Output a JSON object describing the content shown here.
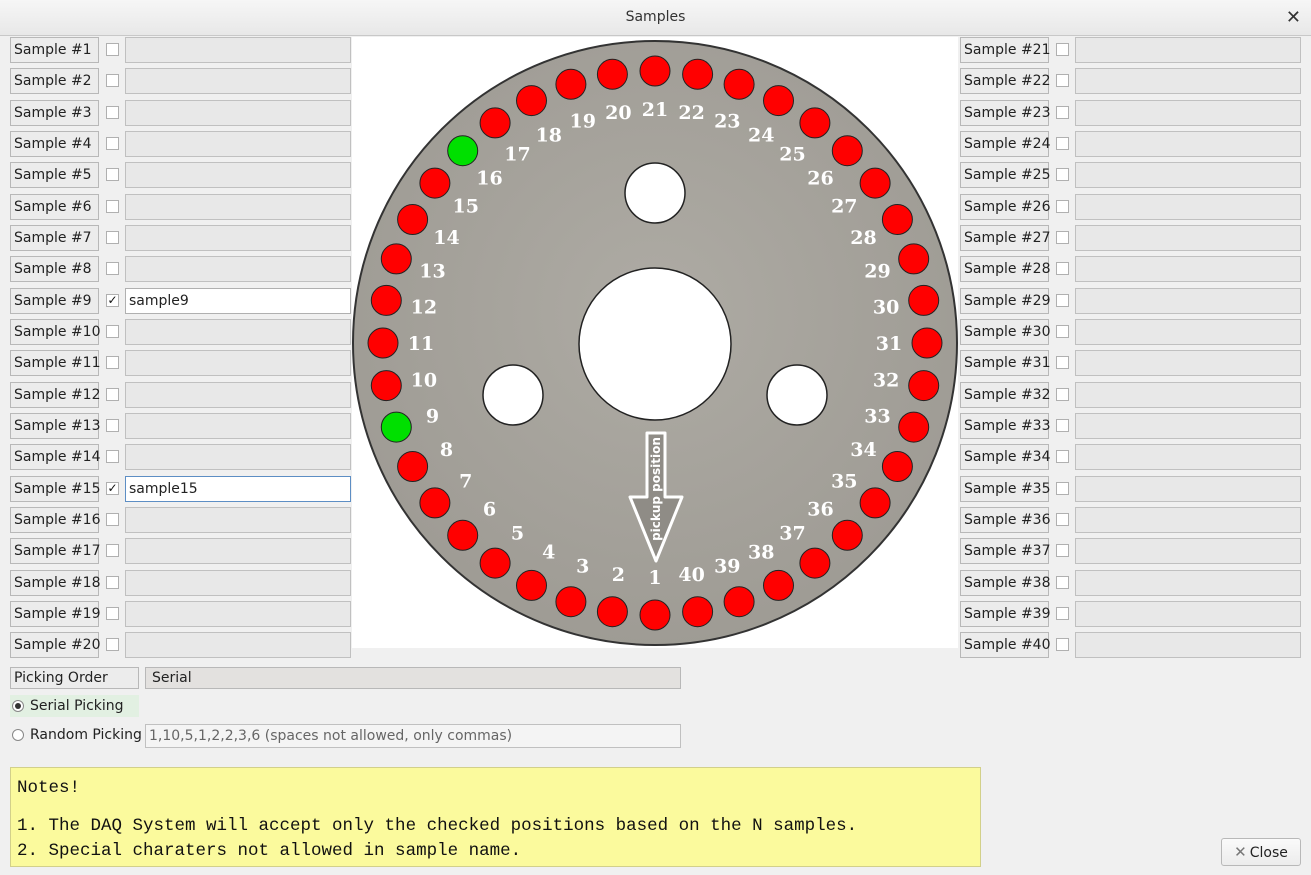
{
  "window": {
    "title": "Samples",
    "close_glyph": "✕"
  },
  "samples_left": [
    {
      "label": "Sample #1",
      "checked": false,
      "value": ""
    },
    {
      "label": "Sample #2",
      "checked": false,
      "value": ""
    },
    {
      "label": "Sample #3",
      "checked": false,
      "value": ""
    },
    {
      "label": "Sample #4",
      "checked": false,
      "value": ""
    },
    {
      "label": "Sample #5",
      "checked": false,
      "value": ""
    },
    {
      "label": "Sample #6",
      "checked": false,
      "value": ""
    },
    {
      "label": "Sample #7",
      "checked": false,
      "value": ""
    },
    {
      "label": "Sample #8",
      "checked": false,
      "value": ""
    },
    {
      "label": "Sample #9",
      "checked": true,
      "value": "sample9"
    },
    {
      "label": "Sample #10",
      "checked": false,
      "value": ""
    },
    {
      "label": "Sample #11",
      "checked": false,
      "value": ""
    },
    {
      "label": "Sample #12",
      "checked": false,
      "value": ""
    },
    {
      "label": "Sample #13",
      "checked": false,
      "value": ""
    },
    {
      "label": "Sample #14",
      "checked": false,
      "value": ""
    },
    {
      "label": "Sample #15",
      "checked": true,
      "value": "sample15"
    },
    {
      "label": "Sample #16",
      "checked": false,
      "value": ""
    },
    {
      "label": "Sample #17",
      "checked": false,
      "value": ""
    },
    {
      "label": "Sample #18",
      "checked": false,
      "value": ""
    },
    {
      "label": "Sample #19",
      "checked": false,
      "value": ""
    },
    {
      "label": "Sample #20",
      "checked": false,
      "value": ""
    }
  ],
  "samples_right": [
    {
      "label": "Sample #21",
      "checked": false,
      "value": ""
    },
    {
      "label": "Sample #22",
      "checked": false,
      "value": ""
    },
    {
      "label": "Sample #23",
      "checked": false,
      "value": ""
    },
    {
      "label": "Sample #24",
      "checked": false,
      "value": ""
    },
    {
      "label": "Sample #25",
      "checked": false,
      "value": ""
    },
    {
      "label": "Sample #26",
      "checked": false,
      "value": ""
    },
    {
      "label": "Sample #27",
      "checked": false,
      "value": ""
    },
    {
      "label": "Sample #28",
      "checked": false,
      "value": ""
    },
    {
      "label": "Sample #29",
      "checked": false,
      "value": ""
    },
    {
      "label": "Sample #30",
      "checked": false,
      "value": ""
    },
    {
      "label": "Sample #31",
      "checked": false,
      "value": ""
    },
    {
      "label": "Sample #32",
      "checked": false,
      "value": ""
    },
    {
      "label": "Sample #33",
      "checked": false,
      "value": ""
    },
    {
      "label": "Sample #34",
      "checked": false,
      "value": ""
    },
    {
      "label": "Sample #35",
      "checked": false,
      "value": ""
    },
    {
      "label": "Sample #36",
      "checked": false,
      "value": ""
    },
    {
      "label": "Sample #37",
      "checked": false,
      "value": ""
    },
    {
      "label": "Sample #38",
      "checked": false,
      "value": ""
    },
    {
      "label": "Sample #39",
      "checked": false,
      "value": ""
    },
    {
      "label": "Sample #40",
      "checked": false,
      "value": ""
    }
  ],
  "check_glyph": "✓",
  "plate": {
    "positions": 40,
    "selected": [
      9,
      16
    ],
    "pickup_label": "pickup position",
    "colors": {
      "plate": "#a6a39c",
      "empty": "#ff0000",
      "selected": "#00e000",
      "hole": "#ffffff",
      "number": "#ffffff"
    }
  },
  "picking": {
    "order_label": "Picking Order",
    "order_value": "Serial",
    "serial_label": "Serial Picking",
    "random_label": "Random Picking",
    "selected_mode": "serial",
    "random_placeholder": "1,10,5,1,2,2,3,6 (spaces not allowed, only commas)"
  },
  "notes": {
    "title": "Notes!",
    "line1": "1. The DAQ System will accept only the checked positions based on the N samples.",
    "line2": "2. Special charaters not allowed in sample name."
  },
  "close_button": {
    "label": "Close",
    "icon": "close-icon"
  }
}
